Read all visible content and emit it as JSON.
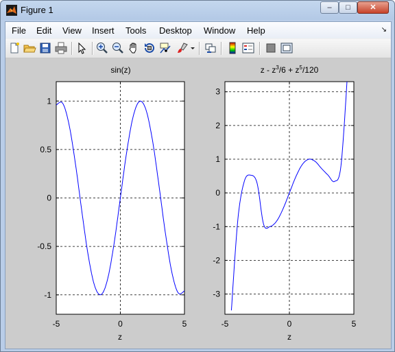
{
  "window": {
    "title": "Figure 1",
    "minimize": "–",
    "maximize": "□",
    "close": "✕"
  },
  "menu": {
    "items": [
      "File",
      "Edit",
      "View",
      "Insert",
      "Tools",
      "Desktop",
      "Window",
      "Help"
    ]
  },
  "toolbar": {
    "icons": [
      "new-figure-icon",
      "open-file-icon",
      "save-icon",
      "print-icon",
      "edit-plot-arrow-icon",
      "zoom-in-icon",
      "zoom-out-icon",
      "pan-hand-icon",
      "rotate-3d-icon",
      "data-cursor-icon",
      "brush-icon",
      "brush-dropdown-icon",
      "link-plot-icon",
      "colorbar-icon",
      "legend-icon",
      "hide-plot-tools-icon",
      "show-plot-tools-icon"
    ]
  },
  "colors": {
    "line": "#0000ff",
    "figure_bg": "#cccccc",
    "axes_bg": "#ffffff"
  },
  "chart_data": [
    {
      "type": "line",
      "title": "sin(z)",
      "xlabel": "z",
      "ylabel": "",
      "xlim": [
        -5,
        5
      ],
      "ylim": [
        -1.2,
        1.2
      ],
      "xticks": [
        -5,
        0,
        5
      ],
      "yticks": [
        -1,
        -0.5,
        0,
        0.5,
        1
      ],
      "xtick_labels": [
        "-5",
        "0",
        "5"
      ],
      "ytick_labels": [
        "-1",
        "-0.5",
        "0",
        "0.5",
        "1"
      ],
      "grid": true,
      "series": [
        {
          "x": [
            -5,
            -4.5,
            -4,
            -3.5,
            -3,
            -2.5,
            -2,
            -1.5,
            -1,
            -0.5,
            0,
            0.5,
            1,
            1.5,
            2,
            2.5,
            3,
            3.5,
            4,
            4.5,
            5
          ],
          "y": [
            0.959,
            0.978,
            0.757,
            0.351,
            -0.141,
            -0.598,
            -0.909,
            -0.997,
            -0.841,
            -0.479,
            0,
            0.479,
            0.841,
            0.997,
            0.909,
            0.598,
            0.141,
            -0.351,
            -0.757,
            -0.978,
            -0.959
          ]
        }
      ]
    },
    {
      "type": "line",
      "title_parts": [
        "z - z",
        "3",
        "/6 + z",
        "5",
        "/120"
      ],
      "xlabel": "z",
      "ylabel": "",
      "xlim": [
        -5,
        5
      ],
      "ylim": [
        -3.6,
        3.3
      ],
      "xticks": [
        -5,
        0,
        5
      ],
      "yticks": [
        -3,
        -2,
        -1,
        0,
        1,
        2,
        3
      ],
      "xtick_labels": [
        "-5",
        "0",
        "5"
      ],
      "ytick_labels": [
        "-3",
        "-2",
        "-1",
        "0",
        "1",
        "2",
        "3"
      ],
      "grid": true,
      "series": [
        {
          "x": [
            -4.5,
            -4,
            -3.5,
            -3,
            -2.5,
            -2,
            -1.5,
            -1,
            -0.5,
            0,
            0.5,
            1,
            1.5,
            2,
            2.5,
            3,
            3.5,
            4,
            4.5
          ],
          "y": [
            -3.483,
            -0.802,
            0.341,
            0.525,
            0.279,
            -0.933,
            -0.998,
            -0.842,
            -0.479,
            0,
            0.479,
            0.842,
            0.998,
            0.933,
            0.721,
            0.525,
            0.341,
            0.802,
            3.483
          ]
        }
      ]
    }
  ]
}
